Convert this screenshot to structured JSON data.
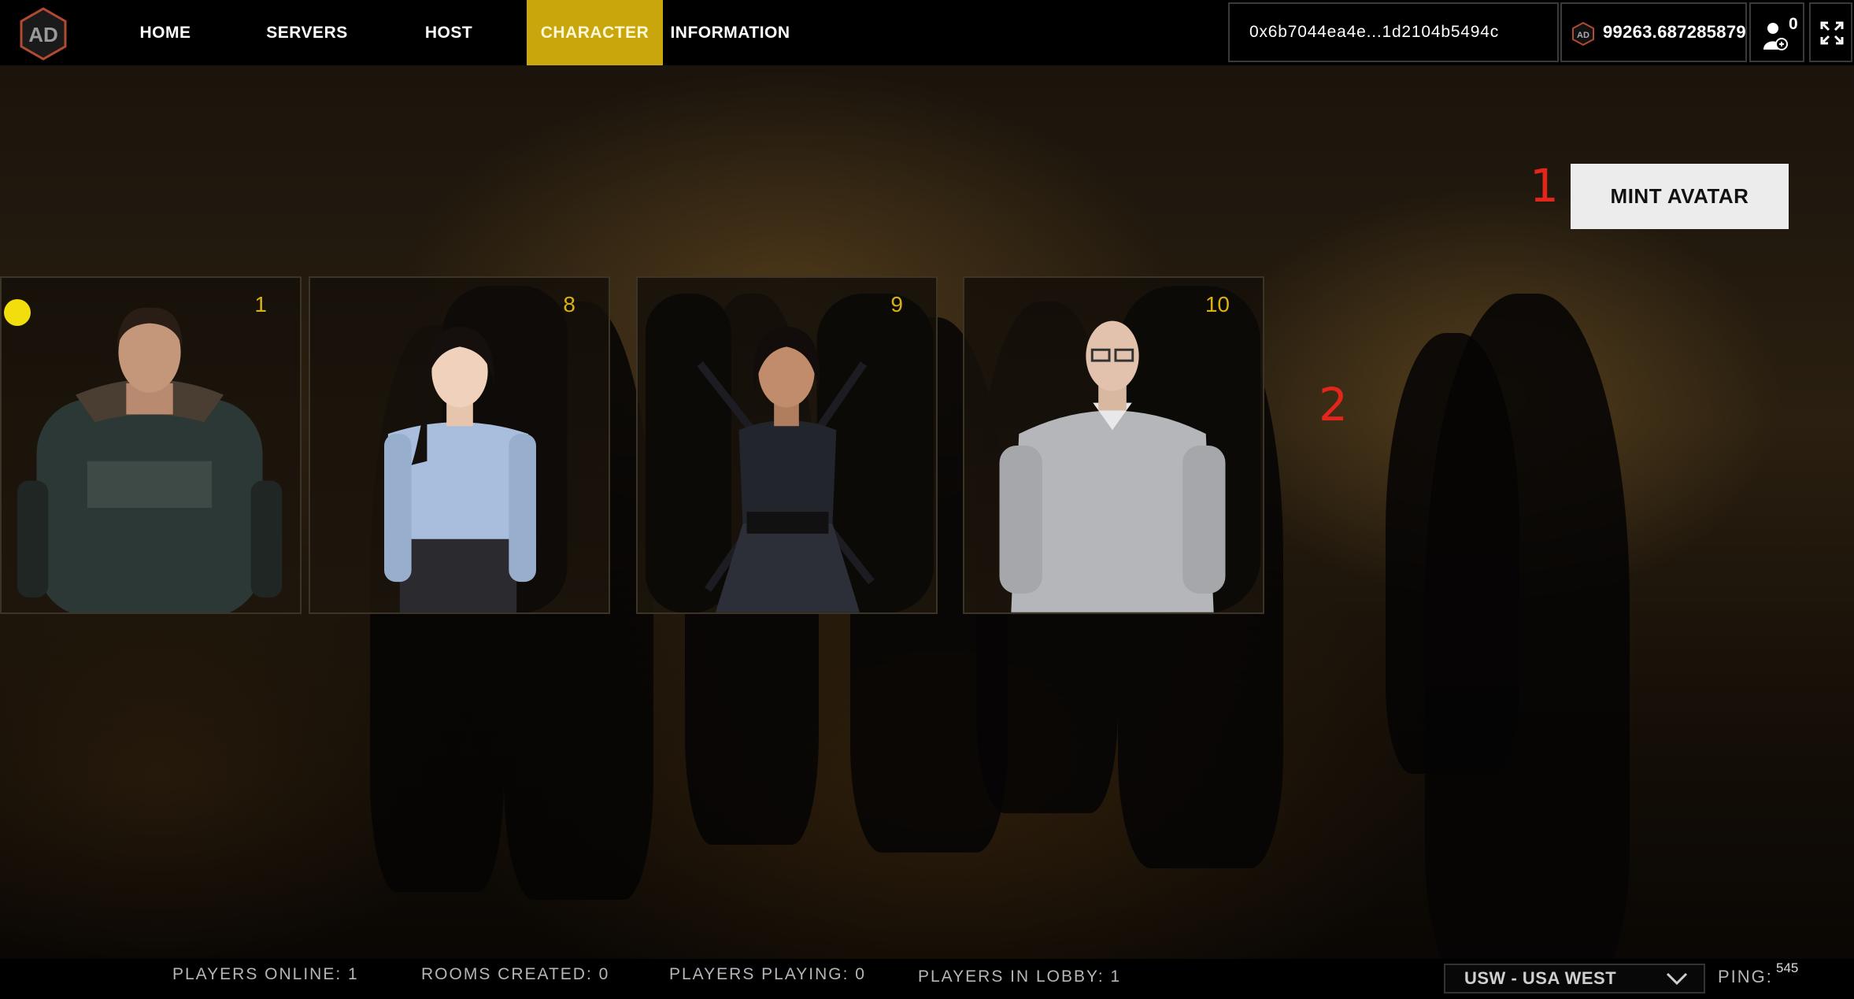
{
  "nav": {
    "items": [
      {
        "label": "HOME"
      },
      {
        "label": "SERVERS"
      },
      {
        "label": "HOST"
      },
      {
        "label": "CHARACTER",
        "active": true
      },
      {
        "label": "INFORMATION"
      }
    ],
    "logo_icon": "ad-hexagon-logo",
    "wallet_address": "0x6b7044ea4e...1d2104b5494c",
    "balance": "99263.68728587906",
    "online_users_count": "0",
    "accent_color": "#c9a70c"
  },
  "mint": {
    "button_label": "MINT AVATAR"
  },
  "annotations": {
    "marker_1": "1",
    "marker_2": "2",
    "color": "#e3261b"
  },
  "avatars": [
    {
      "number": "1",
      "selected": true,
      "description_icon": "hooded-jacket-avatar"
    },
    {
      "number": "8",
      "selected": false,
      "description_icon": "blouse-woman-avatar"
    },
    {
      "number": "9",
      "selected": false,
      "description_icon": "dress-swords-avatar"
    },
    {
      "number": "10",
      "selected": false,
      "description_icon": "sweater-man-avatar"
    }
  ],
  "stats": {
    "players_online": "PLAYERS ONLINE: 1",
    "rooms_created": "ROOMS CREATED: 0",
    "players_playing": "PLAYERS PLAYING: 0",
    "players_in_lobby": "PLAYERS IN LOBBY: 1"
  },
  "region": {
    "selected": "USW - USA WEST"
  },
  "ping": {
    "label": "PING:",
    "value": "545"
  }
}
